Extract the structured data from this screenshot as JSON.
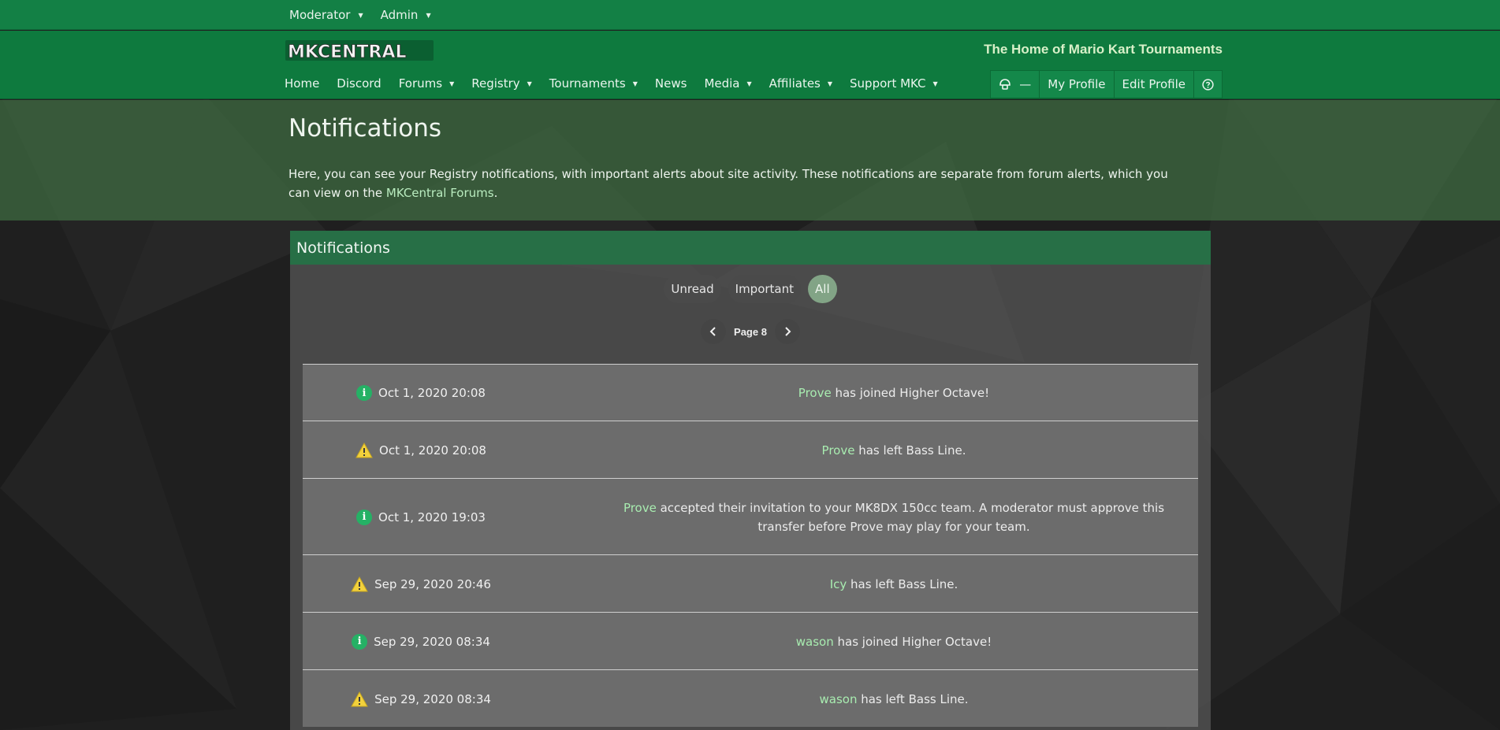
{
  "topbar": {
    "menus": [
      {
        "label": "Moderator"
      },
      {
        "label": "Admin"
      }
    ]
  },
  "header": {
    "logo_text": "MKCENTRAL",
    "tagline": "The Home of Mario Kart Tournaments",
    "nav": [
      {
        "label": "Home",
        "dropdown": false
      },
      {
        "label": "Discord",
        "dropdown": false
      },
      {
        "label": "Forums",
        "dropdown": true
      },
      {
        "label": "Registry",
        "dropdown": true
      },
      {
        "label": "Tournaments",
        "dropdown": true
      },
      {
        "label": "News",
        "dropdown": false
      },
      {
        "label": "Media",
        "dropdown": true
      },
      {
        "label": "Affiliates",
        "dropdown": true
      },
      {
        "label": "Support MKC",
        "dropdown": true
      }
    ],
    "user": {
      "notification_count": "—",
      "my_profile": "My Profile",
      "edit_profile": "Edit Profile"
    }
  },
  "hero": {
    "title": "Notifications",
    "description": "Here, you can see your Registry notifications, with important alerts about site activity. These notifications are separate from forum alerts, which you can view on the",
    "link": "MKCentral Forums",
    "end": "."
  },
  "panel": {
    "title": "Notifications",
    "filters": [
      {
        "label": "Unread",
        "active": false
      },
      {
        "label": "Important",
        "active": false
      },
      {
        "label": "All",
        "active": true
      }
    ],
    "page_label": "Page 8"
  },
  "notifications": [
    {
      "type": "info",
      "icon": "info-icon",
      "time": "Oct 1, 2020 20:08",
      "user": "Prove",
      "text": " has joined Higher Octave!"
    },
    {
      "type": "warning",
      "icon": "warning-icon",
      "time": "Oct 1, 2020 20:08",
      "user": "Prove",
      "text": " has left Bass Line."
    },
    {
      "type": "info",
      "icon": "info-icon",
      "time": "Oct 1, 2020 19:03",
      "user": "Prove",
      "text": " accepted their invitation to your MK8DX 150cc team. A moderator must approve this transfer before Prove may play for your team."
    },
    {
      "type": "warning",
      "icon": "warning-icon",
      "time": "Sep 29, 2020 20:46",
      "user": "Icy",
      "text": " has left Bass Line."
    },
    {
      "type": "info",
      "icon": "info-icon",
      "time": "Sep 29, 2020 08:34",
      "user": "wason",
      "text": " has joined Higher Octave!"
    },
    {
      "type": "warning",
      "icon": "warning-icon",
      "time": "Sep 29, 2020 08:34",
      "user": "wason",
      "text": " has left Bass Line."
    }
  ],
  "colors": {
    "topbar": "#138045",
    "header": "#0e7a3e",
    "accent_link": "#a8ecb0",
    "info": "#25b165",
    "warning": "#f2d13c"
  }
}
